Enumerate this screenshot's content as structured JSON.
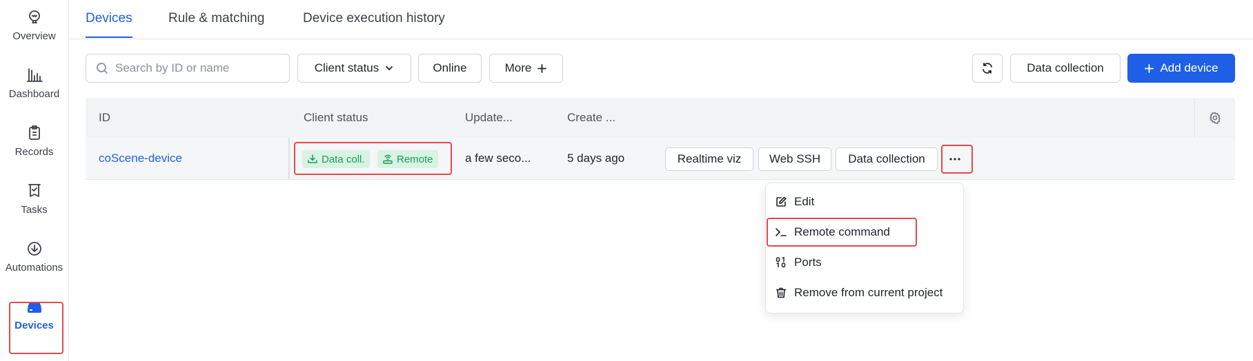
{
  "sidebar": {
    "items": [
      {
        "label": "Overview",
        "icon": "bulb-icon"
      },
      {
        "label": "Dashboard",
        "icon": "bar-chart-icon"
      },
      {
        "label": "Records",
        "icon": "clipboard-icon"
      },
      {
        "label": "Tasks",
        "icon": "task-icon"
      },
      {
        "label": "Automations",
        "icon": "automation-icon"
      },
      {
        "label": "Devices",
        "icon": "device-icon",
        "active": true
      }
    ]
  },
  "tabs": [
    "Devices",
    "Rule & matching",
    "Device execution history"
  ],
  "toolbar": {
    "search_placeholder": "Search by ID or name",
    "client_status_label": "Client status",
    "online_label": "Online",
    "more_label": "More",
    "data_collection_label": "Data collection",
    "add_device_label": "Add device"
  },
  "table": {
    "columns": [
      "ID",
      "Client status",
      "Update...",
      "Create ..."
    ],
    "rows": [
      {
        "id": "coScene-device",
        "tags": [
          "Data coll.",
          "Remote"
        ],
        "updated": "a few seco...",
        "created": "5 days ago",
        "actions": [
          "Realtime viz",
          "Web SSH",
          "Data collection"
        ]
      }
    ]
  },
  "menu": {
    "items": [
      {
        "label": "Edit",
        "icon": "edit-icon"
      },
      {
        "label": "Remote command",
        "icon": "terminal-icon"
      },
      {
        "label": "Ports",
        "icon": "binary-icon"
      },
      {
        "label": "Remove from current project",
        "icon": "trash-icon"
      }
    ]
  },
  "colors": {
    "accent": "#1f5fe6",
    "tag_bg": "#d7f3e3",
    "tag_text": "#1f9a5a",
    "highlight": "#e5484d"
  }
}
